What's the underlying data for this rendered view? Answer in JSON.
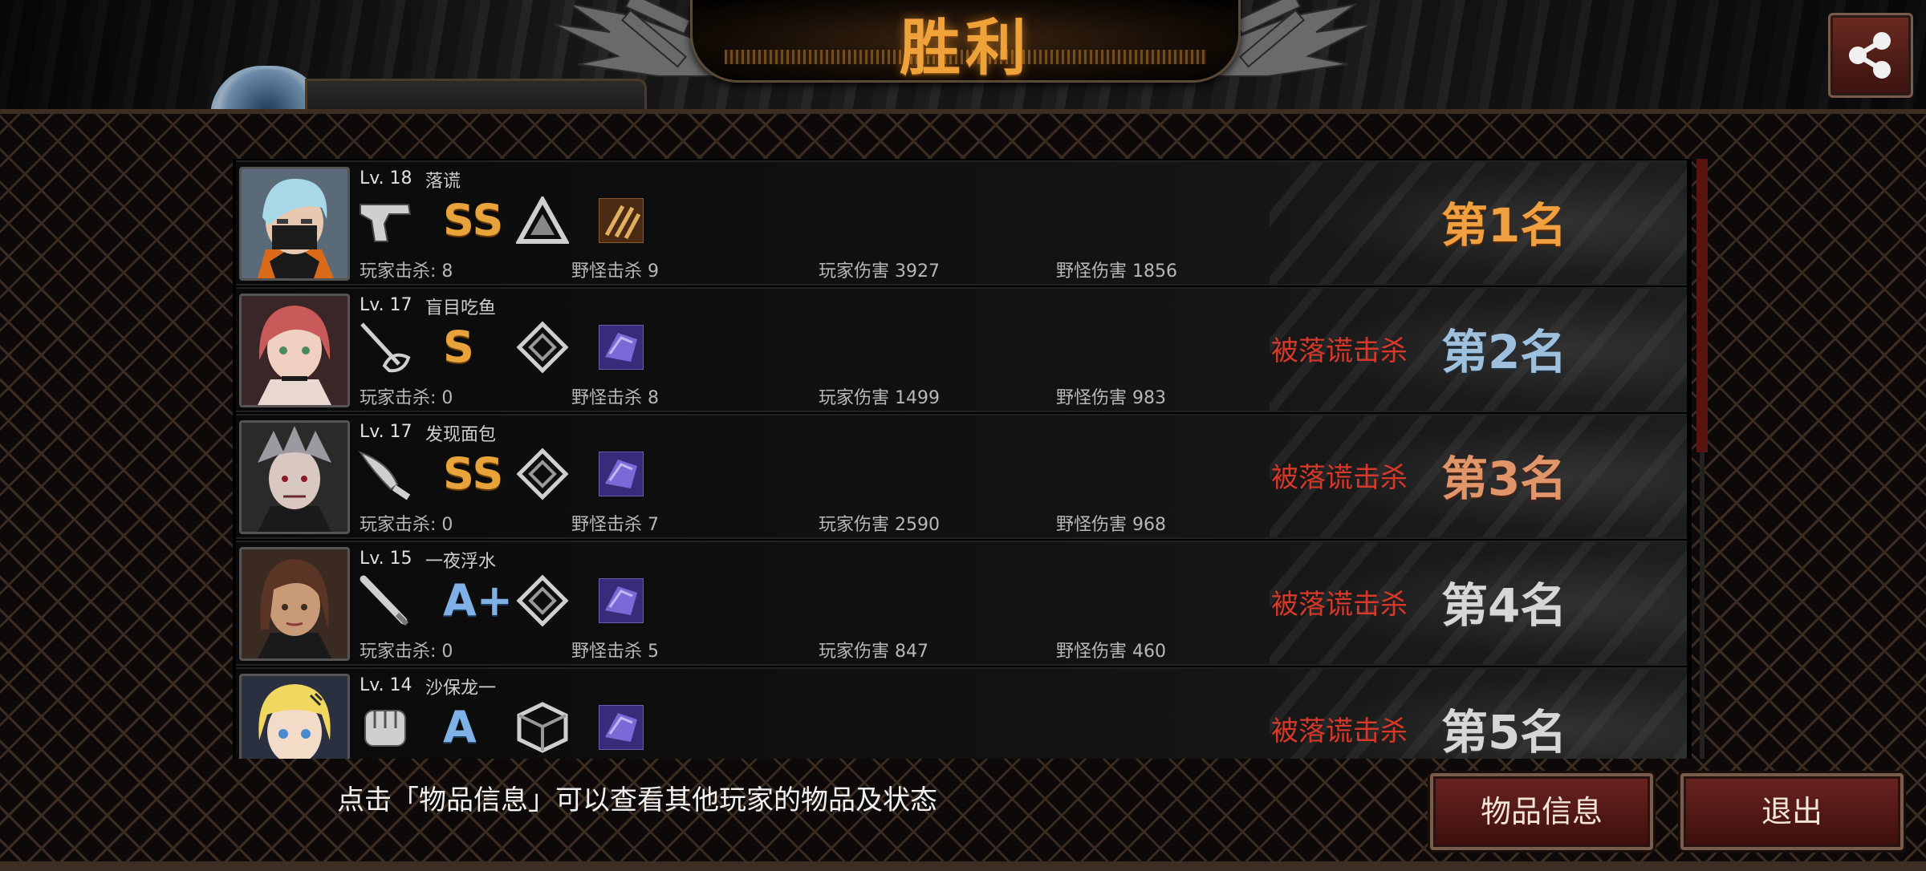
{
  "header": {
    "title": "胜利"
  },
  "players": [
    {
      "level": "Lv. 18",
      "name": "落谎",
      "weapon_icon": "pistol-icon",
      "grade": "SS",
      "rank_emblem_icon": "triangle-rank-icon",
      "item_icon": "bullets-item-icon",
      "player_kills": "玩家击杀: 8",
      "monster_kills": "野怪击杀 9",
      "player_damage": "玩家伤害 3927",
      "monster_damage": "野怪伤害 1856",
      "killed_by": "",
      "rank": "第1名"
    },
    {
      "level": "Lv. 17",
      "name": "盲目吃鱼",
      "weapon_icon": "rapier-icon",
      "grade": "S",
      "rank_emblem_icon": "diamond-rank-icon",
      "item_icon": "purple-item-icon",
      "player_kills": "玩家击杀: 0",
      "monster_kills": "野怪击杀 8",
      "player_damage": "玩家伤害 1499",
      "monster_damage": "野怪伤害 983",
      "killed_by": "被落谎击杀",
      "rank": "第2名"
    },
    {
      "level": "Lv. 17",
      "name": "发现面包",
      "weapon_icon": "knife-icon",
      "grade": "SS",
      "rank_emblem_icon": "diamond-rank-icon",
      "item_icon": "purple-item-icon",
      "player_kills": "玩家击杀: 0",
      "monster_kills": "野怪击杀 7",
      "player_damage": "玩家伤害 2590",
      "monster_damage": "野怪伤害 968",
      "killed_by": "被落谎击杀",
      "rank": "第3名"
    },
    {
      "level": "Lv. 15",
      "name": "一夜浮水",
      "weapon_icon": "bat-icon",
      "grade": "A+",
      "rank_emblem_icon": "diamond-rank-icon",
      "item_icon": "purple-item-icon",
      "player_kills": "玩家击杀: 0",
      "monster_kills": "野怪击杀 5",
      "player_damage": "玩家伤害 847",
      "monster_damage": "野怪伤害 460",
      "killed_by": "被落谎击杀",
      "rank": "第4名"
    },
    {
      "level": "Lv. 14",
      "name": "沙保龙一",
      "weapon_icon": "fist-icon",
      "grade": "A",
      "rank_emblem_icon": "cube-rank-icon",
      "item_icon": "purple-item-icon",
      "player_kills": "",
      "monster_kills": "",
      "player_damage": "",
      "monster_damage": "",
      "killed_by": "被落谎击杀",
      "rank": "第5名"
    }
  ],
  "footer": {
    "hint": "点击「物品信息」可以查看其他玩家的物品及状态",
    "items_button": "物品信息",
    "exit_button": "退出"
  },
  "colors": {
    "accent_gold": "#f0a23a",
    "killed_red": "#d6382a",
    "button_red": "#6a2320"
  }
}
